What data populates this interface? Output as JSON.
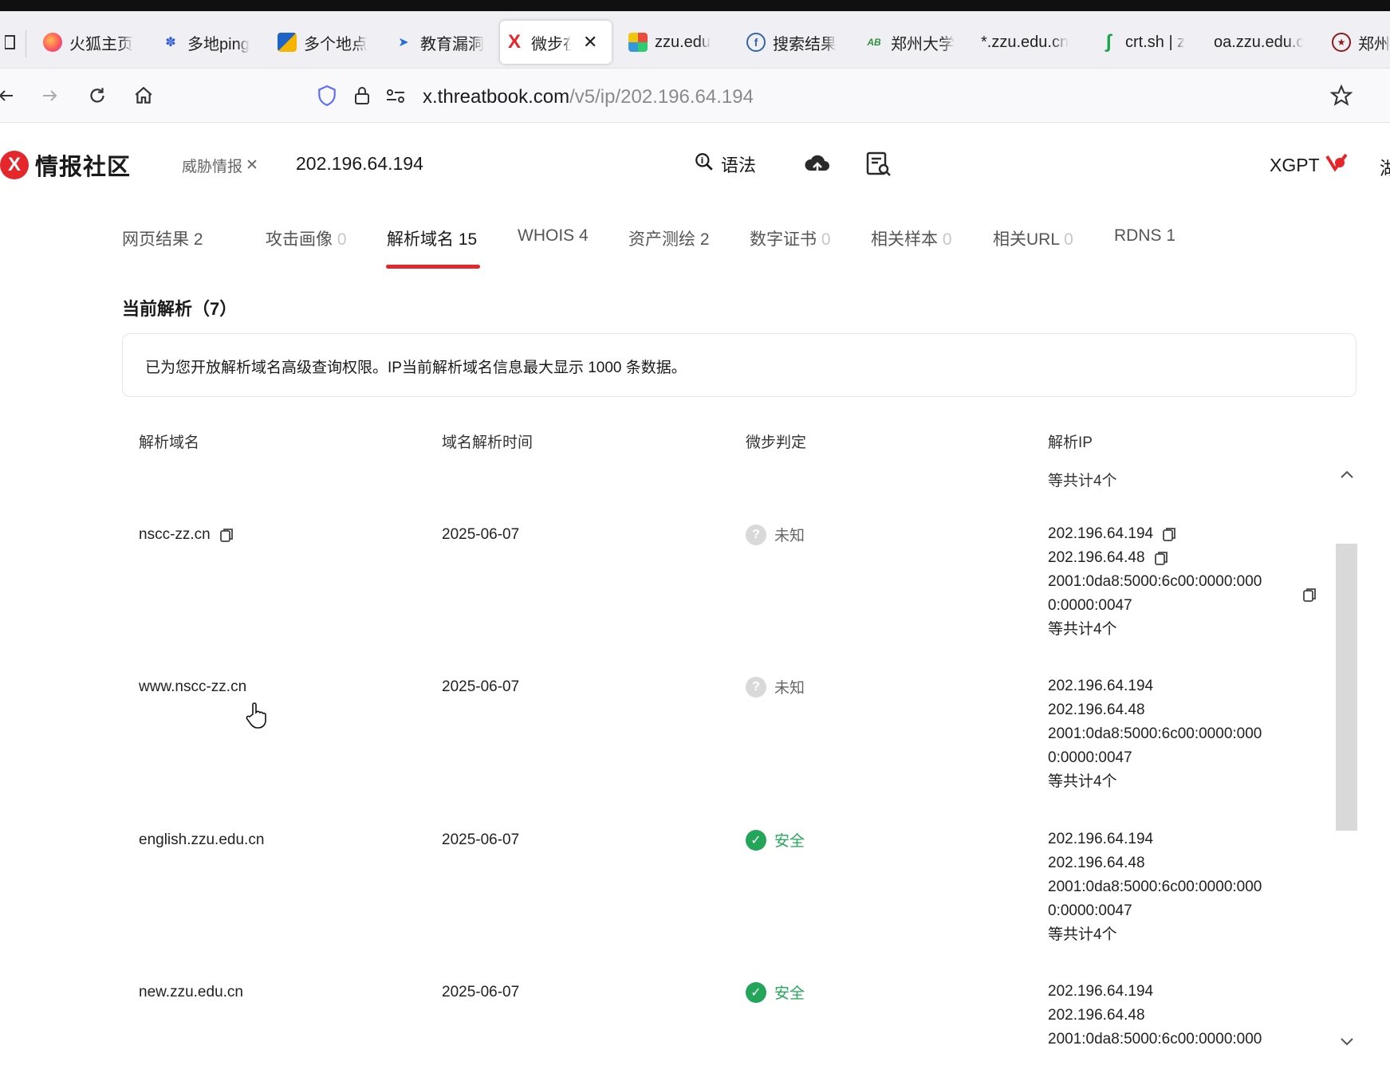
{
  "browser": {
    "tabs": [
      {
        "title": "火狐主页",
        "icon": "firefox-icon",
        "active": false
      },
      {
        "title": "多地ping",
        "icon": "paw-icon",
        "active": false
      },
      {
        "title": "多个地点",
        "icon": "chart-icon",
        "active": false
      },
      {
        "title": "教育漏洞",
        "icon": "bird-icon",
        "active": false
      },
      {
        "title": "微步在线",
        "icon": "threatbook-icon",
        "active": true
      },
      {
        "title": "zzu.edu",
        "icon": "puzzle-icon",
        "active": false
      },
      {
        "title": "搜索结果",
        "icon": "fofa-icon",
        "active": false
      },
      {
        "title": "郑州大学",
        "icon": "ab-icon",
        "active": false
      },
      {
        "title": "*.zzu.edu.cn",
        "icon": "",
        "active": false
      },
      {
        "title": "crt.sh | z",
        "icon": "crtsh-icon",
        "active": false
      },
      {
        "title": "oa.zzu.edu.c",
        "icon": "",
        "active": false
      },
      {
        "title": "郑州",
        "icon": "seal-icon",
        "active": false
      }
    ],
    "url": {
      "prefix": "x.",
      "host": "threatbook.com",
      "path": "/v5/ip/202.196.64.194"
    }
  },
  "header": {
    "logo_text": "情报社区",
    "logo_letter": "X",
    "search_chip": "威胁情报",
    "search_value": "202.196.64.194",
    "syntax_label": "语法",
    "xgpt_label": "XGPT",
    "clipped_item": "湖"
  },
  "result_tabs": [
    {
      "label": "网页结果",
      "count": "2",
      "zero": false
    },
    {
      "label": "攻击画像",
      "count": "0",
      "zero": true
    },
    {
      "label": "解析域名",
      "count": "15",
      "zero": false,
      "active": true
    },
    {
      "label": "WHOIS",
      "count": "4",
      "zero": false
    },
    {
      "label": "资产测绘",
      "count": "2",
      "zero": false
    },
    {
      "label": "数字证书",
      "count": "0",
      "zero": true
    },
    {
      "label": "相关样本",
      "count": "0",
      "zero": true
    },
    {
      "label": "相关URL",
      "count": "0",
      "zero": true
    },
    {
      "label": "RDNS",
      "count": "1",
      "zero": false
    }
  ],
  "section": {
    "title": "当前解析（7）",
    "notice": "已为您开放解析域名高级查询权限。IP当前解析域名信息最大显示 1000 条数据。"
  },
  "table": {
    "headers": {
      "domain": "解析域名",
      "time": "域名解析时间",
      "verdict": "微步判定",
      "ip": "解析IP"
    },
    "top_summary": "等共计4个",
    "rows": [
      {
        "domain": "nscc-zz.cn",
        "time": "2025-06-07",
        "verdict": "未知",
        "verdict_type": "unknown",
        "ips": [
          "202.196.64.194",
          "202.196.64.48",
          "2001:0da8:5000:6c00:0000:000",
          "0:0000:0047"
        ],
        "summary": "等共计4个"
      },
      {
        "domain": "www.nscc-zz.cn",
        "time": "2025-06-07",
        "verdict": "未知",
        "verdict_type": "unknown",
        "ips": [
          "202.196.64.194",
          "202.196.64.48",
          "2001:0da8:5000:6c00:0000:000",
          "0:0000:0047"
        ],
        "summary": "等共计4个"
      },
      {
        "domain": "english.zzu.edu.cn",
        "time": "2025-06-07",
        "verdict": "安全",
        "verdict_type": "safe",
        "ips": [
          "202.196.64.194",
          "202.196.64.48",
          "2001:0da8:5000:6c00:0000:000",
          "0:0000:0047"
        ],
        "summary": "等共计4个"
      },
      {
        "domain": "new.zzu.edu.cn",
        "time": "2025-06-07",
        "verdict": "安全",
        "verdict_type": "safe",
        "ips": [
          "202.196.64.194",
          "202.196.64.48",
          "2001:0da8:5000:6c00:0000:000"
        ],
        "summary": ""
      }
    ]
  },
  "colors": {
    "accent": "#e5262a",
    "safe": "#23a55a",
    "unknown": "#d9d9d9"
  }
}
